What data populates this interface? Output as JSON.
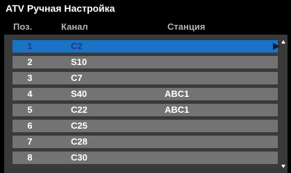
{
  "title": "ATV Ручная Настройка",
  "columns": {
    "position": "Поз.",
    "channel": "Канал",
    "station": "Станция"
  },
  "rows": [
    {
      "pos": "1",
      "channel": "C2",
      "station": "",
      "selected": true
    },
    {
      "pos": "2",
      "channel": "S10",
      "station": ""
    },
    {
      "pos": "3",
      "channel": "C7",
      "station": ""
    },
    {
      "pos": "4",
      "channel": "S40",
      "station": "ABC1"
    },
    {
      "pos": "5",
      "channel": "C22",
      "station": "ABC1"
    },
    {
      "pos": "6",
      "channel": "C25",
      "station": ""
    },
    {
      "pos": "7",
      "channel": "C28",
      "station": ""
    },
    {
      "pos": "8",
      "channel": "C30",
      "station": ""
    }
  ],
  "colors": {
    "background": "#000000",
    "panel": "#3a3a3a",
    "row": "#737373",
    "selected_row": "#1a73c6"
  },
  "icons": {
    "selection": "right-triangle-icon",
    "scroll_up": "scroll-up-arrow-icon",
    "scroll_down": "scroll-down-arrow-icon"
  }
}
